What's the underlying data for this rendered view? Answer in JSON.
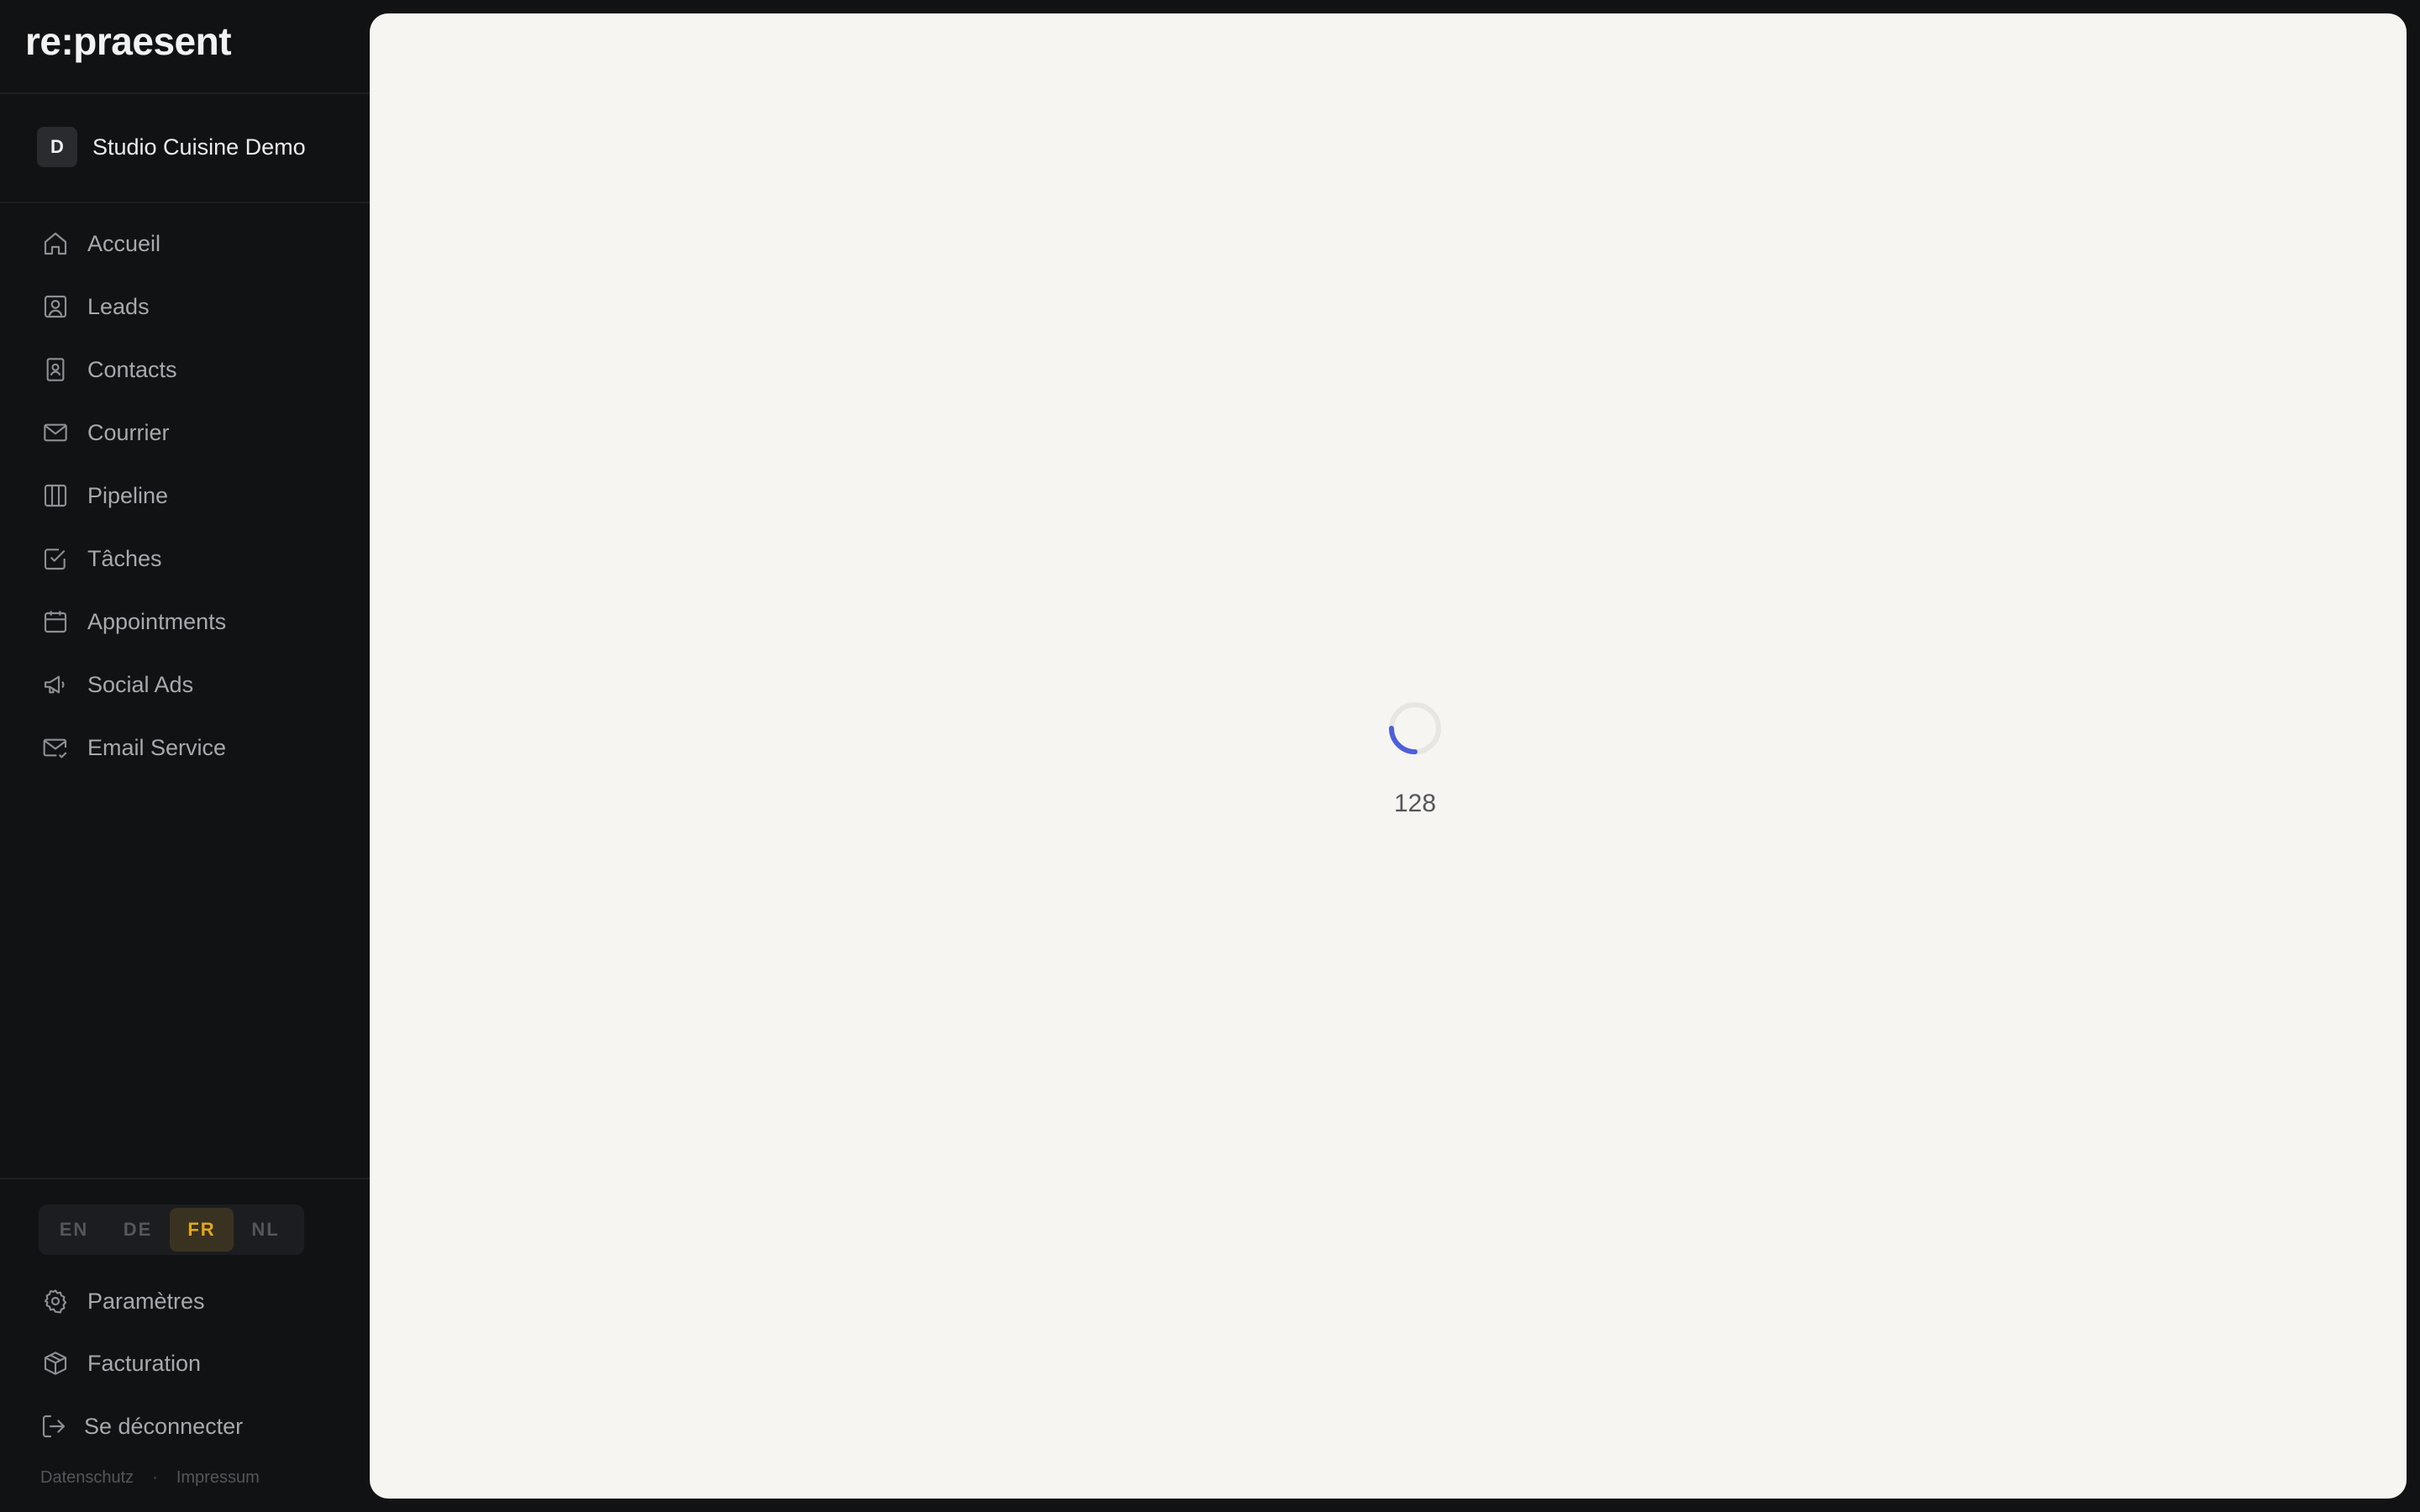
{
  "app": {
    "logo": "re:praesent",
    "workspace": {
      "initial": "D",
      "name": "Studio Cuisine Demo"
    }
  },
  "nav": {
    "items": [
      {
        "label": "Accueil",
        "icon": "home-icon"
      },
      {
        "label": "Leads",
        "icon": "user-square-icon"
      },
      {
        "label": "Contacts",
        "icon": "contact-book-icon"
      },
      {
        "label": "Courrier",
        "icon": "mail-icon"
      },
      {
        "label": "Pipeline",
        "icon": "columns-icon"
      },
      {
        "label": "Tâches",
        "icon": "check-square-icon"
      },
      {
        "label": "Appointments",
        "icon": "calendar-icon"
      },
      {
        "label": "Social Ads",
        "icon": "megaphone-icon"
      },
      {
        "label": "Email Service",
        "icon": "mail-check-icon"
      }
    ]
  },
  "languages": {
    "options": [
      "EN",
      "DE",
      "FR",
      "NL"
    ],
    "selected": "FR",
    "active_color": "#e3a621"
  },
  "bottom_nav": {
    "settings": "Paramètres",
    "billing": "Facturation",
    "logout": "Se déconnecter"
  },
  "footer": {
    "privacy": "Datenschutz",
    "separator": "·",
    "imprint": "Impressum"
  },
  "main": {
    "loading_count": "128",
    "spinner_color": "#4f5fd9"
  }
}
